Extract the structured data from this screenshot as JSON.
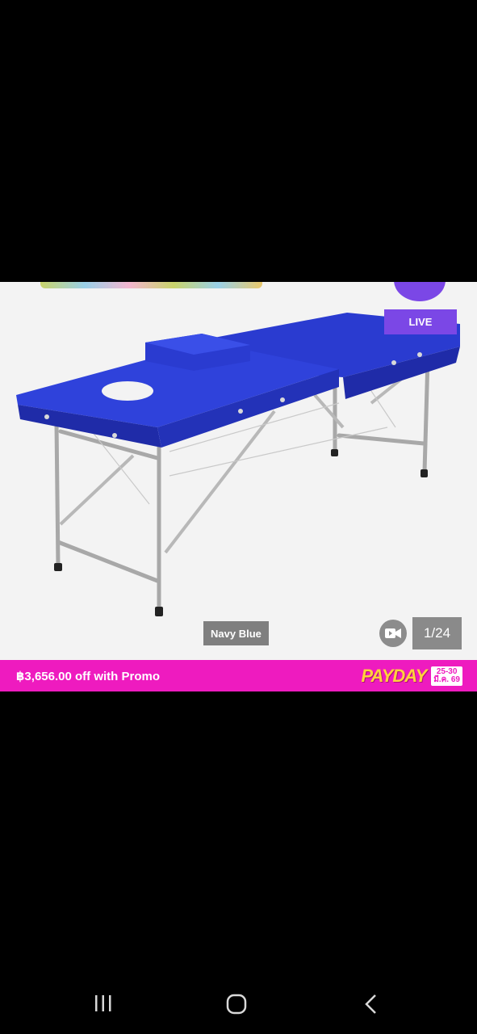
{
  "viewer": {
    "live_label": "LIVE",
    "variant_label": "Navy Blue",
    "image_counter": "1/24",
    "video_icon": "video-camera-icon"
  },
  "promo": {
    "text": "฿3,656.00 off with Promo",
    "logo_text": "PAYDAY",
    "date_top": "25-30",
    "date_bottom": "มี.ค. 69",
    "color": "#ee1bbf"
  },
  "nav": {
    "recent_icon": "recent-apps-icon",
    "home_icon": "home-icon",
    "back_icon": "back-icon"
  },
  "product": {
    "color": "#2a3bd0"
  }
}
